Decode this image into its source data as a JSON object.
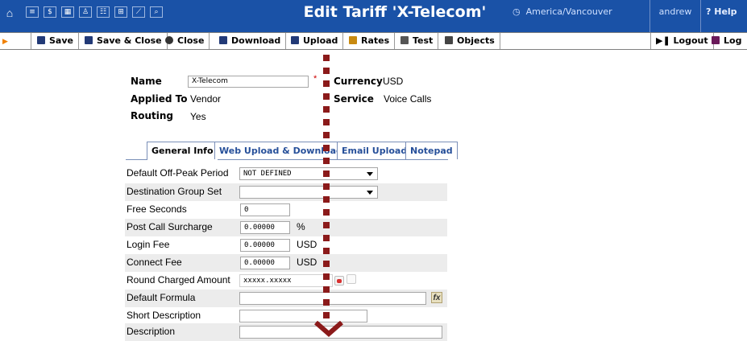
{
  "topbar": {
    "home_icon": "home-icon",
    "nav_icons": [
      "list-icon",
      "dollar-icon",
      "grid-icon",
      "person-icon",
      "tariff-icon",
      "network-icon",
      "chart-icon",
      "search-icon"
    ],
    "title": "Edit Tariff 'X-Telecom'",
    "timezone": "America/Vancouver",
    "user": "andrew",
    "help": "Help"
  },
  "toolbar": {
    "save": "Save",
    "save_close": "Save & Close",
    "close": "Close",
    "download": "Download",
    "upload": "Upload",
    "rates": "Rates",
    "test": "Test",
    "objects": "Objects",
    "logout": "Logout",
    "log": "Log"
  },
  "info": {
    "name_label": "Name",
    "name_value": "X-Telecom",
    "required_mark": "*",
    "currency_label": "Currency",
    "currency_value": "USD",
    "applied_label": "Applied To",
    "applied_value": "Vendor",
    "service_label": "Service",
    "service_value": "Voice Calls",
    "routing_label": "Routing",
    "routing_value": "Yes"
  },
  "tabs": [
    "General Info",
    "Web Upload & Download",
    "Email Upload",
    "Notepad"
  ],
  "form": {
    "offpeak_label": "Default Off-Peak Period",
    "offpeak_value": "NOT DEFINED",
    "destgroup_label": "Destination Group Set",
    "destgroup_value": "",
    "free_seconds_label": "Free Seconds",
    "free_seconds_value": "0",
    "surcharge_label": "Post Call Surcharge",
    "surcharge_value": "0.00000",
    "surcharge_unit": "%",
    "login_fee_label": "Login Fee",
    "login_fee_value": "0.00000",
    "login_fee_unit": "USD",
    "connect_fee_label": "Connect Fee",
    "connect_fee_value": "0.00000",
    "connect_fee_unit": "USD",
    "round_label": "Round Charged Amount",
    "round_value": "xxxxx.xxxxx",
    "formula_label": "Default Formula",
    "formula_value": "",
    "short_desc_label": "Short Description",
    "short_desc_value": "",
    "desc_label": "Description",
    "desc_value": ""
  },
  "colors": {
    "topbar": "#1a52a7",
    "tab_text": "#27509a",
    "row_shade": "#ececec",
    "overlay": "#8b1a1a"
  }
}
